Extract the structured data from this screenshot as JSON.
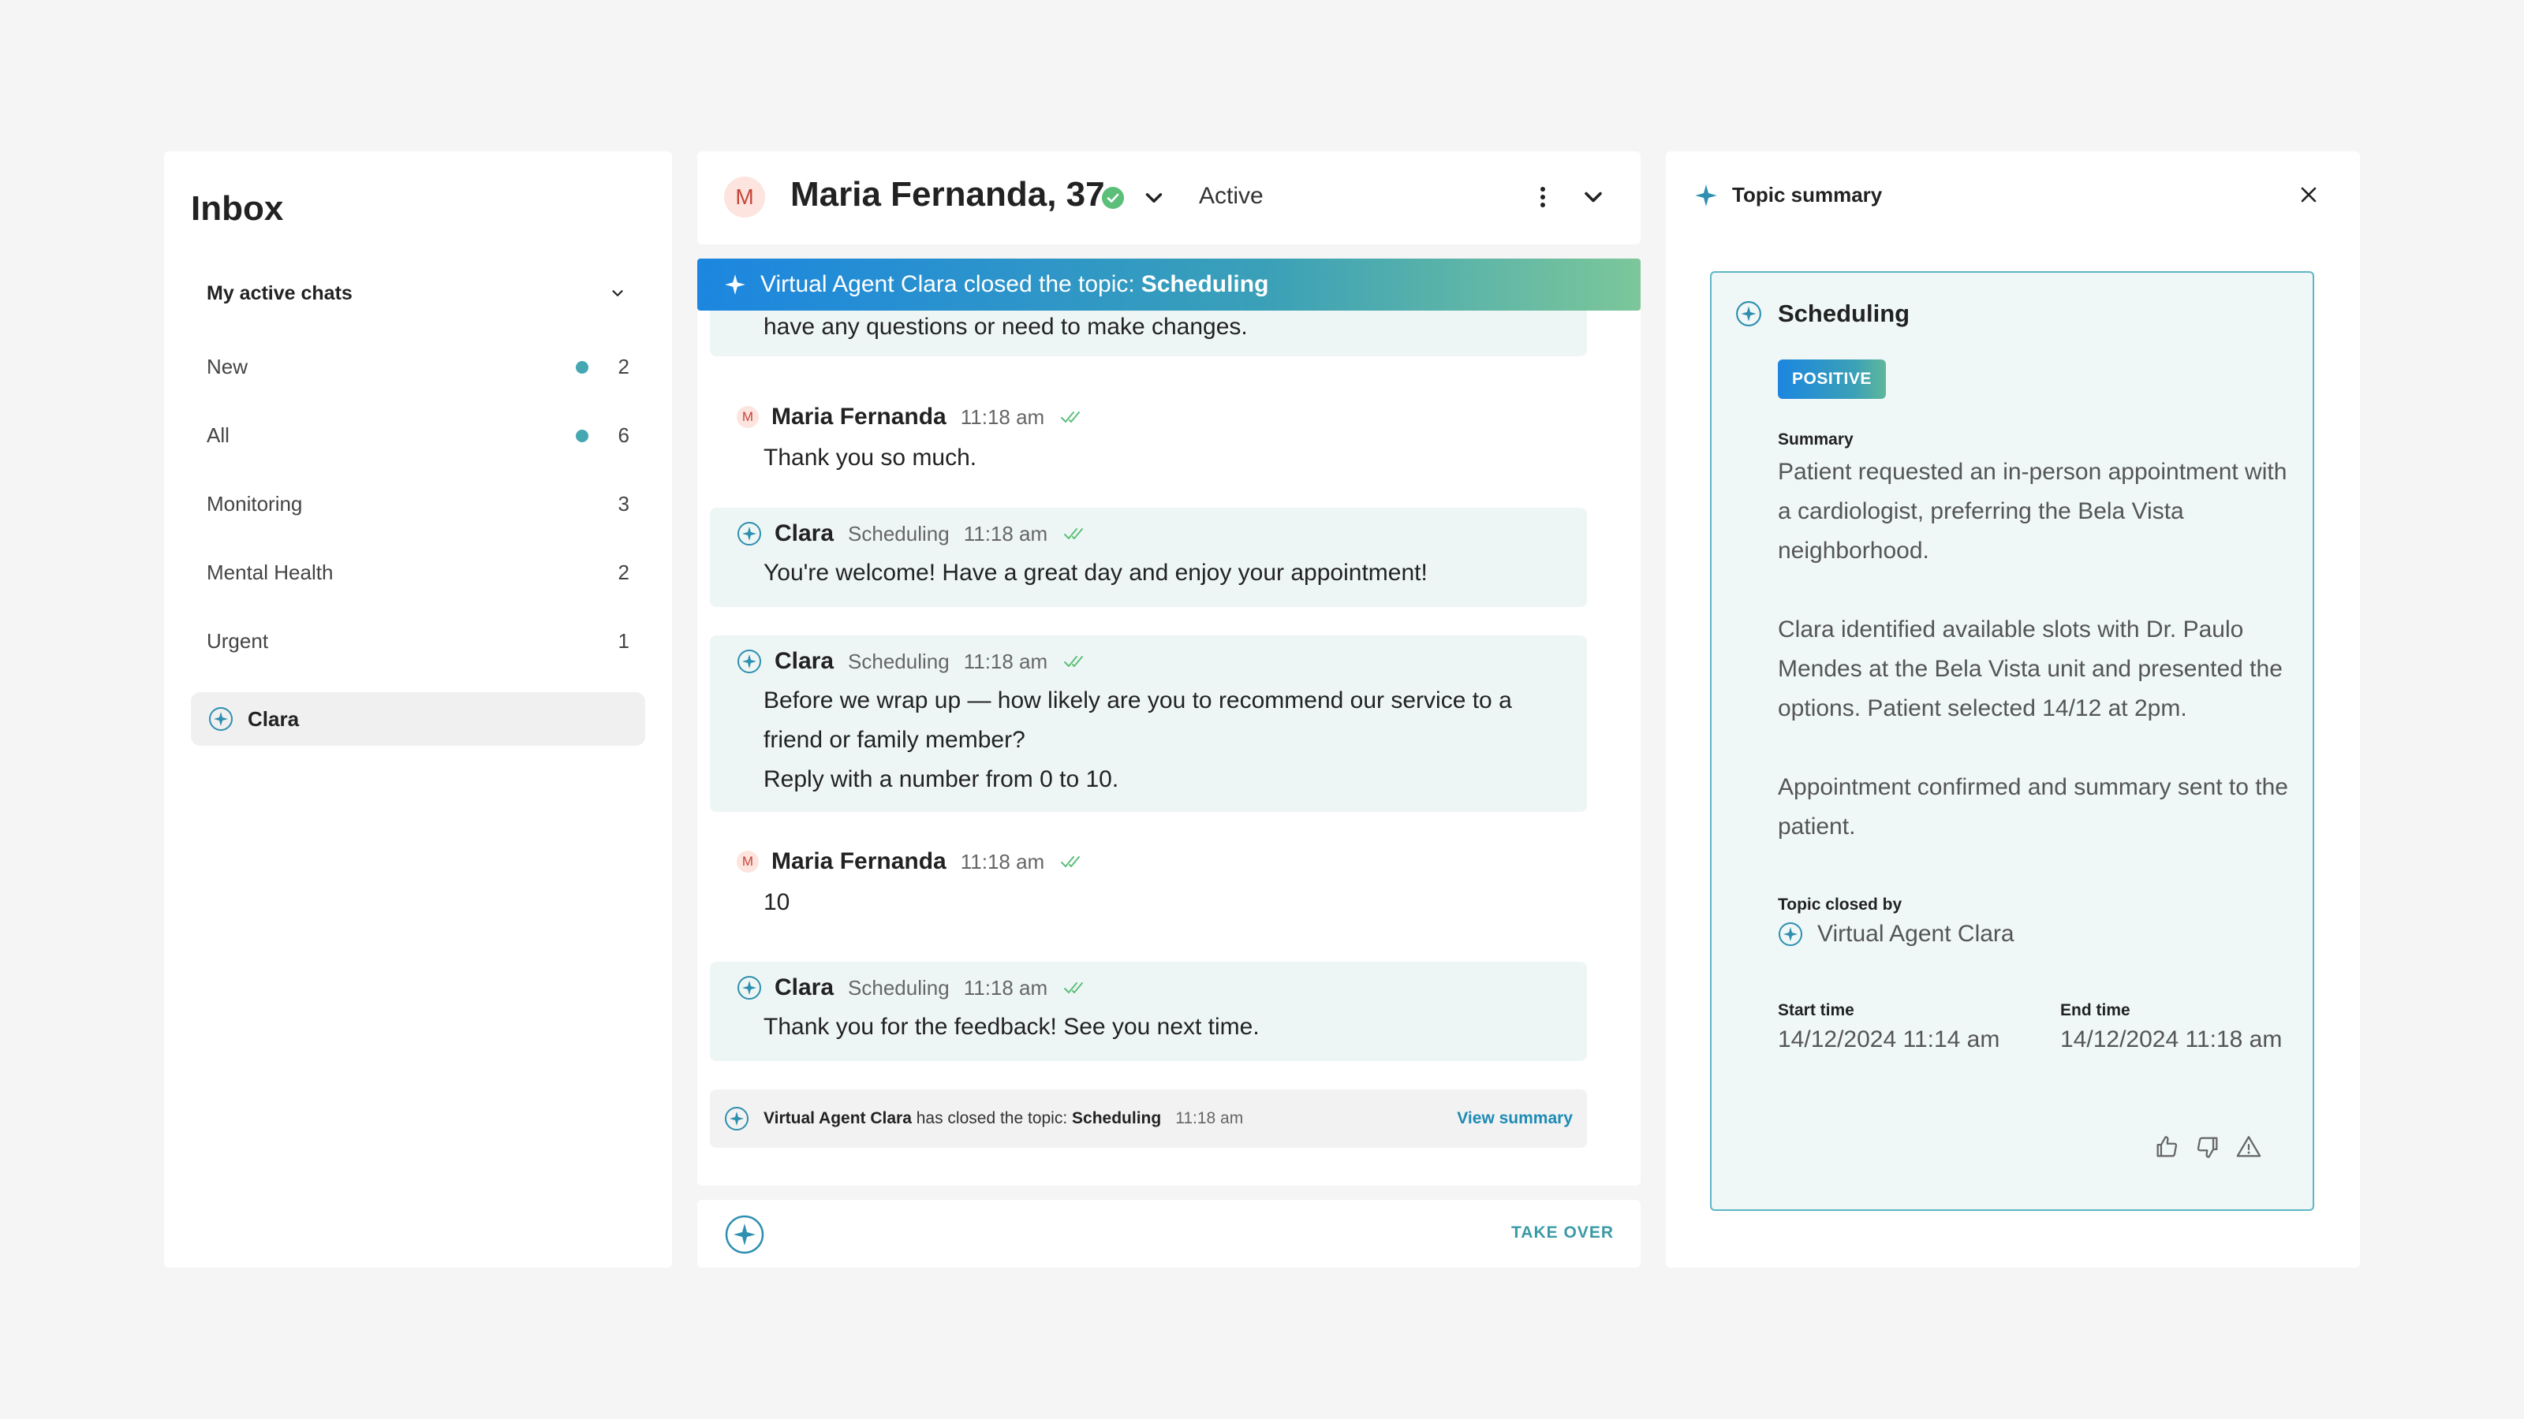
{
  "inbox": {
    "title": "Inbox",
    "filter_label": "My active chats",
    "items": [
      {
        "label": "New",
        "count": "2",
        "unread": true
      },
      {
        "label": "All",
        "count": "6",
        "unread": true
      },
      {
        "label": "Monitoring",
        "count": "3",
        "unread": false
      },
      {
        "label": "Mental Health",
        "count": "2",
        "unread": false
      },
      {
        "label": "Urgent",
        "count": "1",
        "unread": false
      }
    ],
    "agent_item": "Clara"
  },
  "chat": {
    "avatar_initial": "M",
    "patient_name": "Maria Fernanda, 37",
    "status": "Active",
    "banner": {
      "prefix": "Virtual Agent Clara closed the topic:",
      "topic": "Scheduling"
    },
    "partial_text": "have any questions or need to make changes.",
    "messages": [
      {
        "sender": "Maria Fernanda",
        "avatar": "M",
        "time": "11:18 am",
        "text": "Thank you so much."
      },
      {
        "sender": "Clara",
        "topic": "Scheduling",
        "time": "11:18 am",
        "text": "You're welcome! Have a great day and enjoy your appointment!"
      },
      {
        "sender": "Clara",
        "topic": "Scheduling",
        "time": "11:18 am",
        "lines": [
          "Before we wrap up — how likely are you to recommend our service to a",
          "friend or family member?",
          "Reply with a number from 0 to 10."
        ]
      },
      {
        "sender": "Maria Fernanda",
        "avatar": "M",
        "time": "11:18 am",
        "text": "10"
      },
      {
        "sender": "Clara",
        "topic": "Scheduling",
        "time": "11:18 am",
        "text": "Thank you for the feedback! See you next time."
      }
    ],
    "closed_note": {
      "agent": "Virtual Agent Clara",
      "middle": "has closed the topic:",
      "topic": "Scheduling",
      "time": "11:18 am",
      "link": "View summary"
    },
    "take_over": "TAKE OVER"
  },
  "summary": {
    "title": "Topic summary",
    "topic": "Scheduling",
    "sentiment": "POSITIVE",
    "summary_label": "Summary",
    "paragraphs": [
      "Patient requested an in-person appointment with a cardiologist, preferring the Bela Vista neighborhood.",
      "Clara identified available slots with Dr. Paulo Mendes at the Bela Vista unit and presented the options. Patient selected 14/12 at 2pm.",
      "Appointment confirmed and summary sent to the patient."
    ],
    "closed_by_label": "Topic closed by",
    "closed_by": "Virtual Agent Clara",
    "start_label": "Start time",
    "start_value": "14/12/2024 11:14 am",
    "end_label": "End time",
    "end_value": "14/12/2024 11:18 am"
  },
  "colors": {
    "accent": "#45a7b1",
    "bot_bg": "#eef6f5",
    "link": "#1d8bb5",
    "check": "#5bbf7a"
  },
  "icons": [
    "sparkle-icon",
    "chevron-down-icon",
    "verified-icon",
    "more-vertical-icon",
    "close-icon",
    "double-check-icon",
    "thumbs-up-icon",
    "thumbs-down-icon",
    "warning-icon"
  ]
}
